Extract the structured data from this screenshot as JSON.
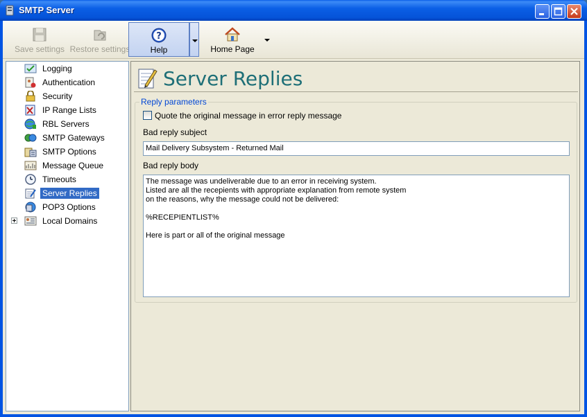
{
  "window": {
    "title": "SMTP Server"
  },
  "toolbar": {
    "save": "Save settings",
    "restore": "Restore settings",
    "help": "Help",
    "home": "Home Page"
  },
  "tree": {
    "items": [
      {
        "label": "Logging",
        "icon": "logging-icon"
      },
      {
        "label": "Authentication",
        "icon": "authentication-icon"
      },
      {
        "label": "Security",
        "icon": "lock-icon"
      },
      {
        "label": "IP Range Lists",
        "icon": "ip-range-icon"
      },
      {
        "label": "RBL Servers",
        "icon": "globe-icon"
      },
      {
        "label": "SMTP Gateways",
        "icon": "gateway-icon"
      },
      {
        "label": "SMTP Options",
        "icon": "options-icon"
      },
      {
        "label": "Message Queue",
        "icon": "queue-icon"
      },
      {
        "label": "Timeouts",
        "icon": "clock-icon"
      },
      {
        "label": "Server Replies",
        "icon": "notepad-icon"
      },
      {
        "label": "POP3 Options",
        "icon": "pop3-icon"
      },
      {
        "label": "Local Domains",
        "icon": "domains-icon"
      }
    ],
    "selected_index": 9
  },
  "page": {
    "title": "Server Replies",
    "group_title": "Reply parameters",
    "quote_label": "Quote the original message in error reply message",
    "quote_checked": false,
    "subject_label": "Bad reply subject",
    "subject_value": "Mail Delivery Subsystem - Returned Mail",
    "body_label": "Bad reply body",
    "body_value": "The message was undeliverable due to an error in receiving system.\nListed are all the recepients with appropriate explanation from remote system\non the reasons, why the message could not be delivered:\n\n%RECEPIENTLIST%\n\nHere is part or all of the original message"
  },
  "colors": {
    "title_accent": "#1e6f77",
    "selection": "#316ac5",
    "legend": "#0046d5"
  }
}
